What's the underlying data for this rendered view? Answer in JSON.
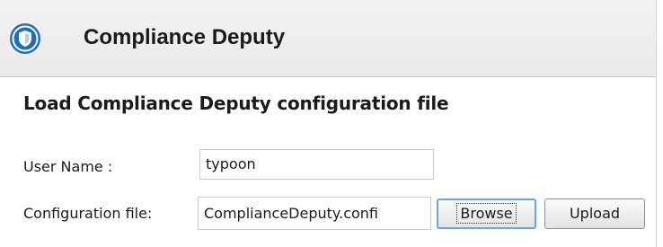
{
  "app": {
    "title": "Compliance Deputy",
    "icon": "shield-icon",
    "accent_color": "#1f6fb8"
  },
  "form": {
    "heading": "Load Compliance Deputy configuration file",
    "user_name_label": "User Name :",
    "user_name_value": "typoon",
    "config_file_label": "Configuration file:",
    "config_file_value": "ComplianceDeputy.confi",
    "browse_label": "Browse",
    "upload_label": "Upload"
  }
}
